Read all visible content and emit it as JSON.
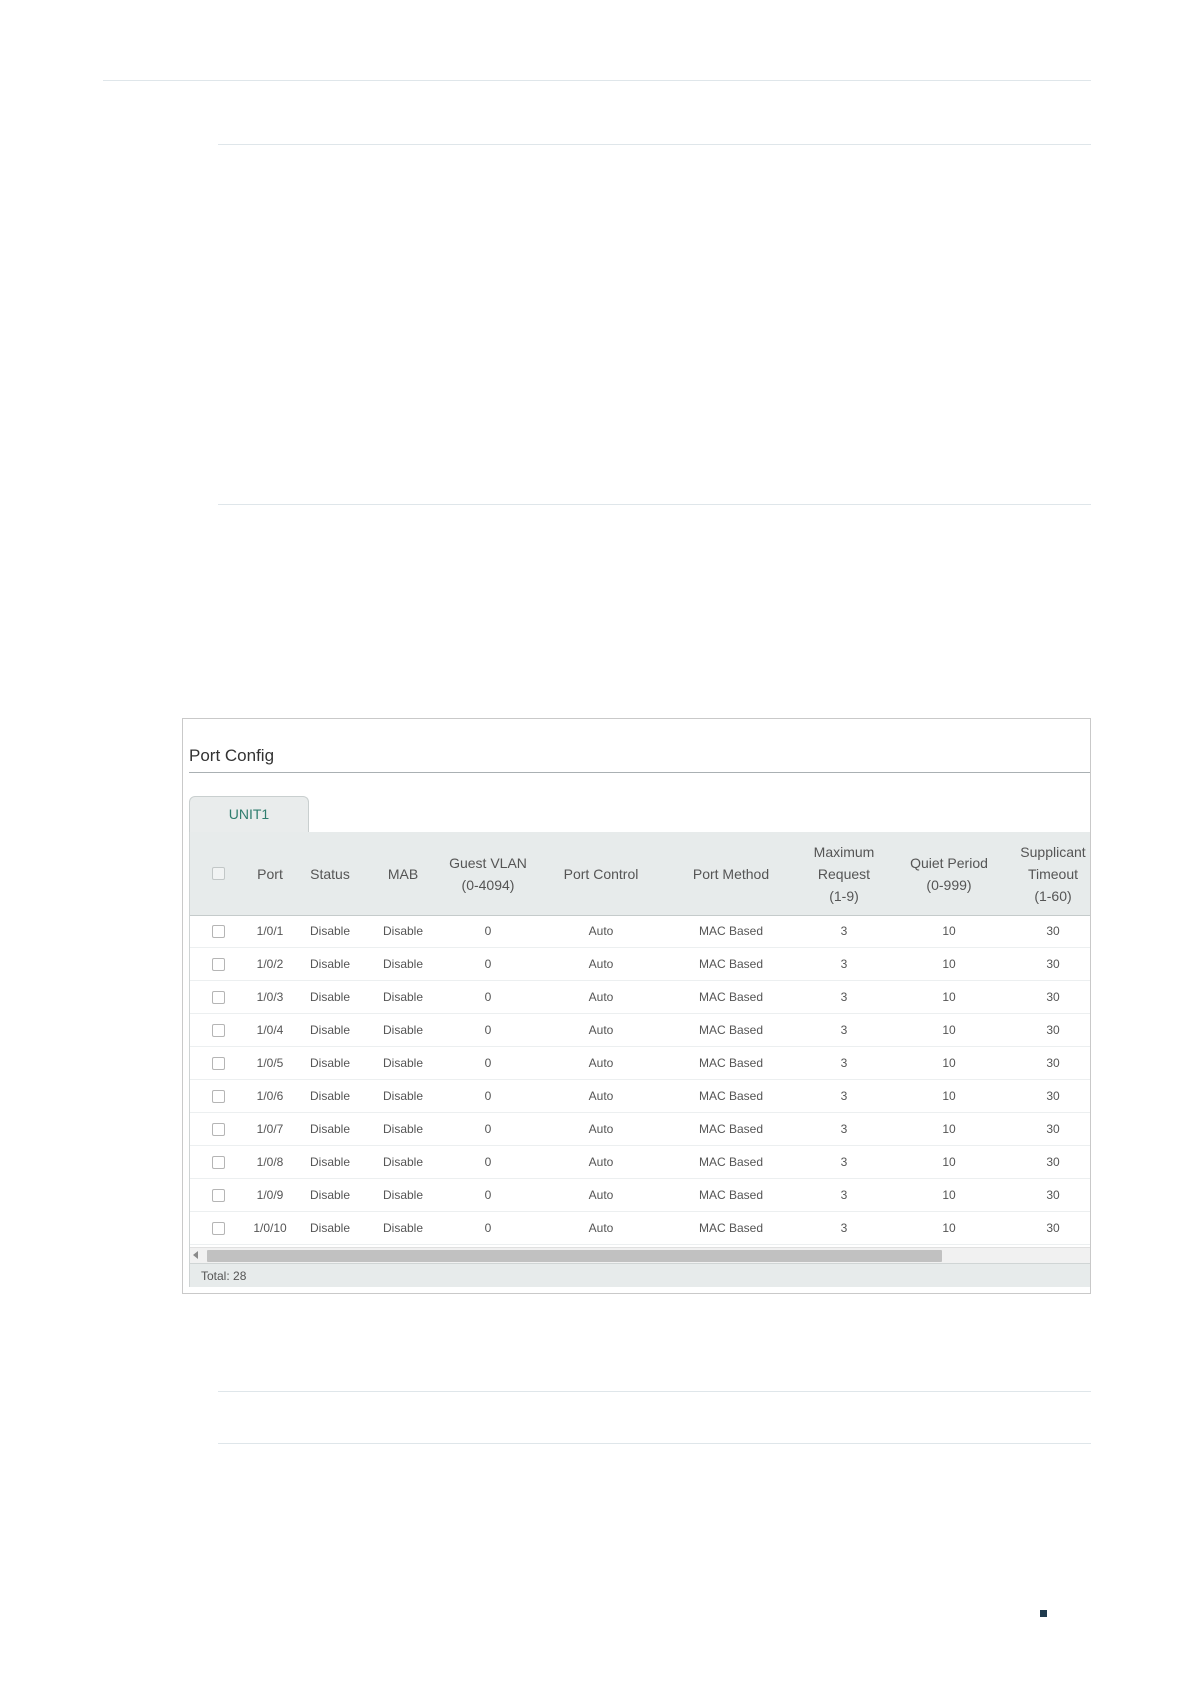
{
  "panel": {
    "title": "Port Config",
    "tab_label": "UNIT1",
    "columns": [
      {
        "label": ""
      },
      {
        "label": "Port"
      },
      {
        "label": "Status"
      },
      {
        "label": "MAB"
      },
      {
        "label": "Guest VLAN\n(0-4094)"
      },
      {
        "label": "Port Control"
      },
      {
        "label": "Port Method"
      },
      {
        "label": "Maximum\nRequest\n(1-9)"
      },
      {
        "label": "Quiet Period\n(0-999)"
      },
      {
        "label": "Supplicant\nTimeout\n(1-60)"
      }
    ],
    "rows": [
      {
        "port": "1/0/1",
        "status": "Disable",
        "mab": "Disable",
        "guest_vlan": "0",
        "port_control": "Auto",
        "port_method": "MAC Based",
        "max_request": "3",
        "quiet_period": "10",
        "supplicant_timeout": "30"
      },
      {
        "port": "1/0/2",
        "status": "Disable",
        "mab": "Disable",
        "guest_vlan": "0",
        "port_control": "Auto",
        "port_method": "MAC Based",
        "max_request": "3",
        "quiet_period": "10",
        "supplicant_timeout": "30"
      },
      {
        "port": "1/0/3",
        "status": "Disable",
        "mab": "Disable",
        "guest_vlan": "0",
        "port_control": "Auto",
        "port_method": "MAC Based",
        "max_request": "3",
        "quiet_period": "10",
        "supplicant_timeout": "30"
      },
      {
        "port": "1/0/4",
        "status": "Disable",
        "mab": "Disable",
        "guest_vlan": "0",
        "port_control": "Auto",
        "port_method": "MAC Based",
        "max_request": "3",
        "quiet_period": "10",
        "supplicant_timeout": "30"
      },
      {
        "port": "1/0/5",
        "status": "Disable",
        "mab": "Disable",
        "guest_vlan": "0",
        "port_control": "Auto",
        "port_method": "MAC Based",
        "max_request": "3",
        "quiet_period": "10",
        "supplicant_timeout": "30"
      },
      {
        "port": "1/0/6",
        "status": "Disable",
        "mab": "Disable",
        "guest_vlan": "0",
        "port_control": "Auto",
        "port_method": "MAC Based",
        "max_request": "3",
        "quiet_period": "10",
        "supplicant_timeout": "30"
      },
      {
        "port": "1/0/7",
        "status": "Disable",
        "mab": "Disable",
        "guest_vlan": "0",
        "port_control": "Auto",
        "port_method": "MAC Based",
        "max_request": "3",
        "quiet_period": "10",
        "supplicant_timeout": "30"
      },
      {
        "port": "1/0/8",
        "status": "Disable",
        "mab": "Disable",
        "guest_vlan": "0",
        "port_control": "Auto",
        "port_method": "MAC Based",
        "max_request": "3",
        "quiet_period": "10",
        "supplicant_timeout": "30"
      },
      {
        "port": "1/0/9",
        "status": "Disable",
        "mab": "Disable",
        "guest_vlan": "0",
        "port_control": "Auto",
        "port_method": "MAC Based",
        "max_request": "3",
        "quiet_period": "10",
        "supplicant_timeout": "30"
      },
      {
        "port": "1/0/10",
        "status": "Disable",
        "mab": "Disable",
        "guest_vlan": "0",
        "port_control": "Auto",
        "port_method": "MAC Based",
        "max_request": "3",
        "quiet_period": "10",
        "supplicant_timeout": "30"
      }
    ],
    "total_label": "Total: 28",
    "tab_color": "#2f7d6e"
  }
}
